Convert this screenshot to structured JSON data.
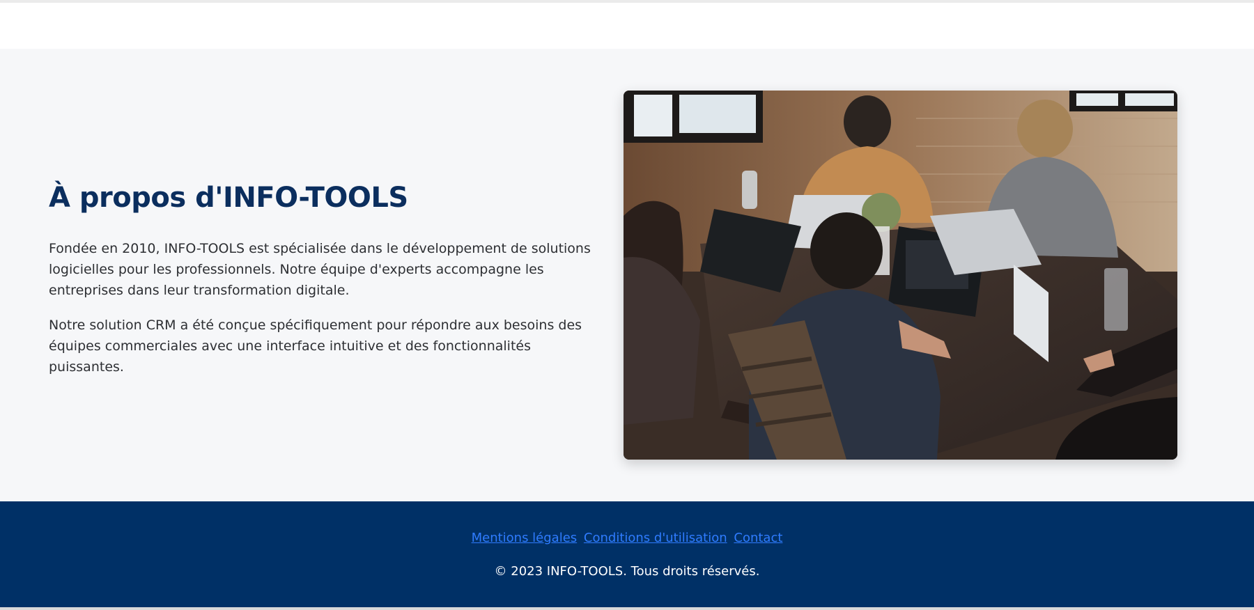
{
  "about": {
    "title": "À propos d'INFO-TOOLS",
    "paragraph_1": "Fondée en 2010, INFO-TOOLS est spécialisée dans le développement de solutions logicielles pour les professionnels. Notre équipe d'experts accompagne les entreprises dans leur transformation digitale.",
    "paragraph_2": "Notre solution CRM a été conçue spécifiquement pour répondre aux besoins des équipes commerciales avec une interface intuitive et des fonctionnalités puissantes.",
    "image_alt": "team-working-at-laptops-photo"
  },
  "footer": {
    "links": [
      {
        "label": "Mentions légales"
      },
      {
        "label": "Conditions d'utilisation"
      },
      {
        "label": "Contact"
      }
    ],
    "copyright": "© 2023 INFO-TOOLS. Tous droits réservés."
  },
  "colors": {
    "title": "#0b2e5e",
    "footer_bg": "#003066",
    "link": "#2f7cff",
    "section_bg": "#f6f7f9"
  }
}
